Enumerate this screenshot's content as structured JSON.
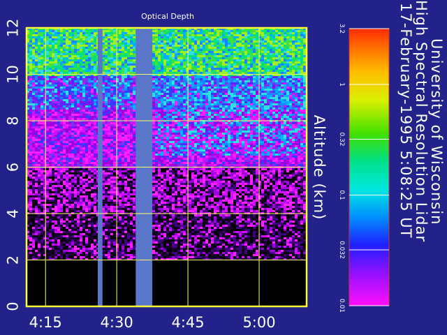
{
  "chart_data": {
    "type": "heatmap",
    "title": "Optical Depth",
    "ylabel": "Altitude (km)",
    "xlabel": "",
    "x_ticks": [
      "4:15",
      "4:30",
      "4:45",
      "5:00"
    ],
    "y_ticks": [
      "0",
      "2",
      "4",
      "6",
      "8",
      "10",
      "12"
    ],
    "y_tick_values": [
      0,
      2,
      4,
      6,
      8,
      10,
      12
    ],
    "ylim": [
      0,
      12
    ],
    "x_tick_minutes": [
      255,
      270,
      285,
      300
    ],
    "xlim_minutes": [
      251,
      310
    ],
    "grid": true,
    "colorbar": {
      "scale": "log",
      "range": [
        0.01,
        3.2
      ],
      "tick_labels": [
        "3.2",
        "1",
        "0.32",
        "0.1",
        "0.032",
        "0.01"
      ],
      "tick_values": [
        3.2,
        1,
        0.32,
        0.1,
        0.032,
        0.01
      ]
    },
    "colors": {
      "background": "#22228a",
      "frame": "#ffff33",
      "grid": "#ffff66",
      "data_gap": "#5a76c8",
      "below_data": "#000000",
      "text": "#ffffff"
    },
    "data_gaps_minutes": [
      [
        266,
        267
      ],
      [
        274,
        277.5
      ]
    ],
    "data_floor_km": 2
  },
  "side_title": {
    "line1": "University of Wisconsin",
    "line2": "High Spectral Resolution Lidar",
    "line3": "17-February-1995   5:08:25 UT"
  }
}
